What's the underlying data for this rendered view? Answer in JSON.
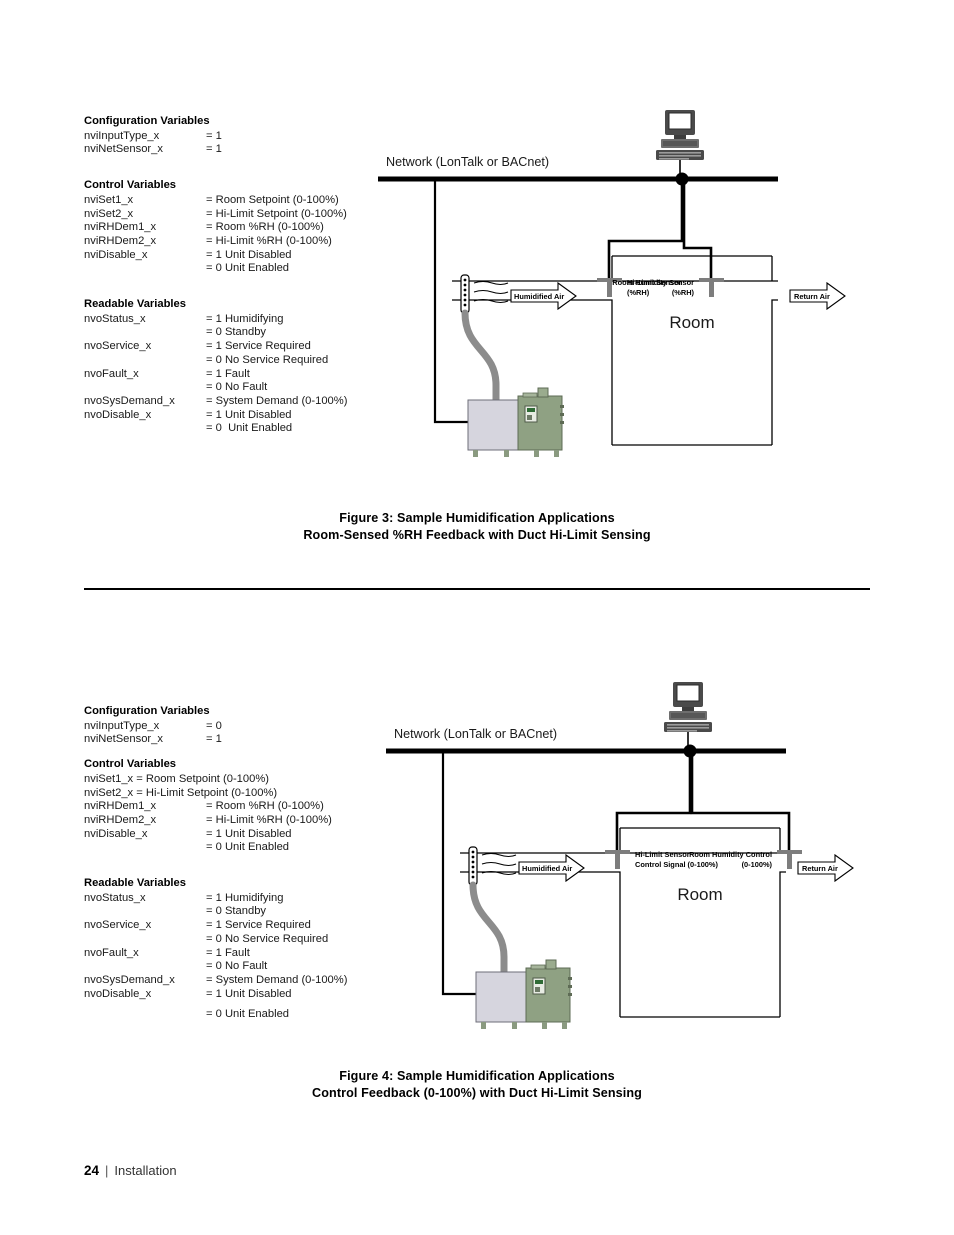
{
  "page": {
    "footer_page_number": "24",
    "footer_separator": "|",
    "footer_section": "Installation"
  },
  "figures": [
    {
      "id": "figure-3",
      "variables": {
        "config_heading": "Configuration Variables",
        "config_rows": [
          {
            "name": "nviInputType_x",
            "value": "= 1"
          },
          {
            "name": "nviNetSensor_x",
            "value": "= 1"
          }
        ],
        "control_heading": "Control Variables",
        "control_rows": [
          {
            "name": "nviSet1_x",
            "value": "= Room Setpoint (0-100%)"
          },
          {
            "name": "nviSet2_x",
            "value": "= Hi-Limit Setpoint (0-100%)"
          },
          {
            "name": "nviRHDem1_x",
            "value": "= Room %RH (0-100%)"
          },
          {
            "name": "nviRHDem2_x",
            "value": "= Hi-Limit %RH (0-100%)"
          },
          {
            "name": "nviDisable_x",
            "value": "= 1 Unit Disabled"
          },
          {
            "name": "",
            "value": "= 0 Unit Enabled"
          }
        ],
        "readable_heading": "Readable Variables",
        "readable_rows": [
          {
            "name": "nvoStatus_x",
            "value": "= 1 Humidifying"
          },
          {
            "name": "",
            "value": "= 0 Standby"
          },
          {
            "name": "nvoService_x",
            "value": "= 1 Service Required"
          },
          {
            "name": "",
            "value": "= 0 No Service Required"
          },
          {
            "name": "nvoFault_x",
            "value": "= 1 Fault"
          },
          {
            "name": "",
            "value": "= 0 No Fault"
          },
          {
            "name": "nvoSysDemand_x",
            "value": "= System Demand (0-100%)"
          },
          {
            "name": "nvoDisable_x",
            "value": "= 1 Unit Disabled"
          },
          {
            "name": "",
            "value": "= 0  Unit Enabled"
          }
        ]
      },
      "diagram": {
        "network_label": "Network (LonTalk or BACnet)",
        "room_label": "Room",
        "humidified_air_label": "Humidified Air",
        "return_air_label": "Return Air",
        "hilimit_sensor_line1": "Hi-Limit Sensor",
        "hilimit_sensor_line2": "(%RH)",
        "room_sensor_line1": "Room Humidity Sensor",
        "room_sensor_line2": "(%RH)"
      },
      "caption_line1": "Figure 3:  Sample Humidification Applications",
      "caption_line2": "Room-Sensed %RH Feedback with Duct Hi-Limit Sensing"
    },
    {
      "id": "figure-4",
      "variables": {
        "config_heading": "Configuration Variables",
        "config_rows": [
          {
            "name": "nviInputType_x",
            "value": "= 0"
          },
          {
            "name": "nviNetSensor_x",
            "value": "= 1"
          }
        ],
        "control_heading": "Control Variables",
        "control_rows_inline": [
          {
            "name": "nviSet1_x ",
            "value": "= Room Setpoint (0-100%)"
          },
          {
            "name": "nviSet2_x ",
            "value": "= Hi-Limit Setpoint (0-100%)"
          }
        ],
        "control_rows": [
          {
            "name": "nviRHDem1_x",
            "value": "= Room %RH (0-100%)"
          },
          {
            "name": "nviRHDem2_x",
            "value": "= Hi-Limit %RH (0-100%)"
          },
          {
            "name": "nviDisable_x",
            "value": "= 1 Unit Disabled"
          },
          {
            "name": "",
            "value": "= 0 Unit Enabled"
          }
        ],
        "readable_heading": "Readable Variables",
        "readable_rows": [
          {
            "name": "nvoStatus_x",
            "value": "= 1 Humidifying"
          },
          {
            "name": "",
            "value": "= 0 Standby"
          },
          {
            "name": "nvoService_x",
            "value": "= 1 Service Required"
          },
          {
            "name": "",
            "value": "= 0 No Service Required"
          },
          {
            "name": "nvoFault_x",
            "value": "= 1 Fault"
          },
          {
            "name": "",
            "value": "= 0 No Fault"
          },
          {
            "name": "nvoSysDemand_x",
            "value": "= System Demand (0-100%)"
          },
          {
            "name": "nvoDisable_x",
            "value": "= 1 Unit Disabled"
          }
        ],
        "readable_last_row": {
          "name": "",
          "value": "= 0 Unit Enabled"
        }
      },
      "diagram": {
        "network_label": "Network (LonTalk or BACnet)",
        "room_label": "Room",
        "humidified_air_label": "Humidified Air",
        "return_air_label": "Return Air",
        "hilimit_sensor_line1": "Hi-Limit Sensor",
        "hilimit_sensor_line2": "Control Signal (0-100%)",
        "room_sensor_line1": "Room Humidity Control",
        "room_sensor_line2": "(0-100%)"
      },
      "caption_line1": "Figure 4:  Sample Humidification Applications",
      "caption_line2": "Control Feedback (0-100%) with Duct Hi-Limit Sensing"
    }
  ],
  "colors": {
    "unit_body_left": "#d6d5de",
    "unit_body_right": "#8fa183",
    "hose": "#8c8c8c",
    "line": "#000000",
    "probe": "#808080"
  }
}
